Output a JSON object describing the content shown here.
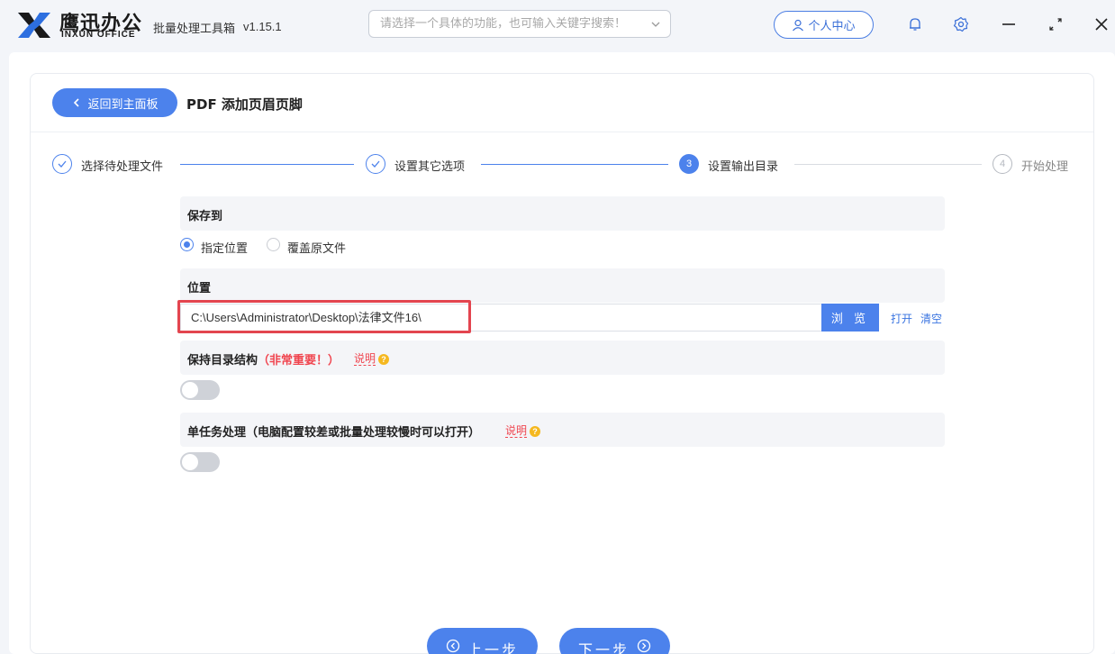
{
  "app": {
    "brand_cn": "鹰迅办公",
    "brand_en": "INXUN OFFICE",
    "title": "批量处理工具箱",
    "version": "v1.15.1"
  },
  "search": {
    "placeholder": "请选择一个具体的功能，也可输入关键字搜索！"
  },
  "header": {
    "user_center_label": "个人中心"
  },
  "page": {
    "back_label": "返回到主面板",
    "title": "PDF 添加页眉页脚"
  },
  "steps": [
    {
      "number": "1",
      "label": "选择待处理文件",
      "state": "done"
    },
    {
      "number": "2",
      "label": "设置其它选项",
      "state": "done"
    },
    {
      "number": "3",
      "label": "设置输出目录",
      "state": "active"
    },
    {
      "number": "4",
      "label": "开始处理",
      "state": "todo"
    }
  ],
  "save_to": {
    "title": "保存到",
    "options": [
      {
        "label": "指定位置",
        "selected": true
      },
      {
        "label": "覆盖原文件",
        "selected": false
      }
    ]
  },
  "location": {
    "title": "位置",
    "path": "C:\\Users\\Administrator\\Desktop\\法律文件16\\",
    "browse_label": "浏 览",
    "open_label": "打开",
    "clear_label": "清空"
  },
  "keep_structure": {
    "title": "保持目录结构",
    "note": "（非常重要！）",
    "explain_label": "说明",
    "enabled": false
  },
  "single_task": {
    "title": "单任务处理（电脑配置较差或批量处理较慢时可以打开）",
    "explain_label": "说明",
    "enabled": false
  },
  "footer": {
    "prev_label": "上一步",
    "next_label": "下一步"
  },
  "colors": {
    "accent": "#4c82ec",
    "highlight": "#e3454f",
    "note_red": "#f0454f"
  }
}
